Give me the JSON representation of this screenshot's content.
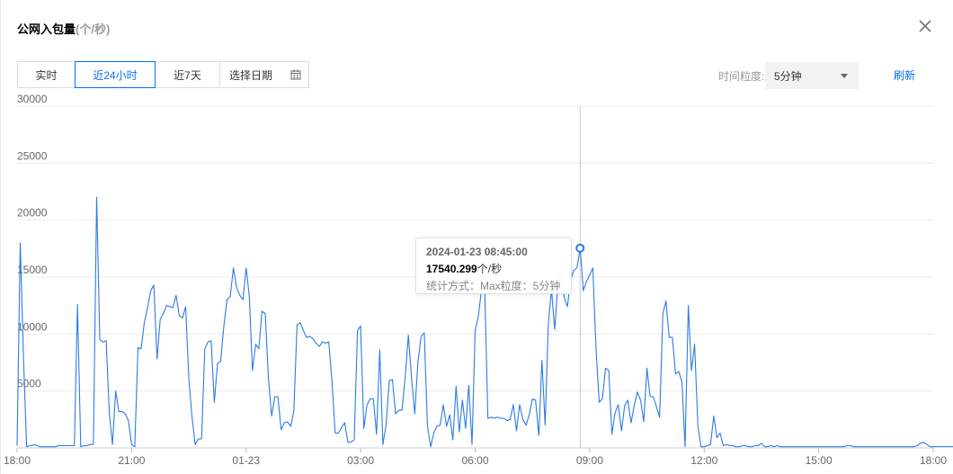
{
  "header": {
    "title": "公网入包量",
    "unit": "(个/秒)"
  },
  "tabs": [
    {
      "label": "实时",
      "active": false
    },
    {
      "label": "近24小时",
      "active": true
    },
    {
      "label": "近7天",
      "active": false
    },
    {
      "label": "选择日期",
      "active": false
    }
  ],
  "granularity": {
    "label": "时间粒度:",
    "value": "5分钟"
  },
  "refresh_label": "刷新",
  "tooltip": {
    "time": "2024-01-23 08:45:00",
    "value": "17540.299",
    "unit": "个/秒",
    "meta": "统计方式：Max粒度：5分钟"
  },
  "colors": {
    "line": "#2b7be4",
    "accent": "#006eff",
    "grid": "#ececec"
  },
  "chart_data": {
    "type": "line",
    "title": "",
    "xlabel": "",
    "ylabel": "",
    "ylim": [
      0,
      30000
    ],
    "yticks": [
      "30000",
      "25000",
      "20000",
      "15000",
      "10000",
      "5000"
    ],
    "xticks": [
      {
        "label": "18:00",
        "h": 0
      },
      {
        "label": "21:00",
        "h": 3
      },
      {
        "label": "01-23",
        "h": 6
      },
      {
        "label": "03:00",
        "h": 9
      },
      {
        "label": "06:00",
        "h": 12
      },
      {
        "label": "09:00",
        "h": 15
      },
      {
        "label": "12:00",
        "h": 18
      },
      {
        "label": "15:00",
        "h": 21
      },
      {
        "label": "18:00",
        "h": 24
      }
    ],
    "x_unit": "hours since 2024-01-22 18:00, 5-minute steps",
    "highlight_index": 177,
    "series": [
      {
        "values": [
          200,
          18000,
          8000,
          100,
          200,
          250,
          250,
          100,
          100,
          100,
          100,
          100,
          100,
          200,
          200,
          200,
          200,
          200,
          200,
          12600,
          100,
          200,
          200,
          300,
          300,
          22000,
          9500,
          9300,
          9400,
          3000,
          300,
          5000,
          3200,
          3200,
          3000,
          2400,
          300,
          100,
          8800,
          8700,
          11000,
          12300,
          13800,
          14300,
          7800,
          11300,
          11800,
          12500,
          12400,
          12300,
          13400,
          11600,
          11400,
          12400,
          6000,
          2700,
          300,
          800,
          800,
          8700,
          9300,
          9400,
          4000,
          7400,
          7600,
          10700,
          13000,
          13300,
          15800,
          14100,
          13400,
          13000,
          15800,
          13300,
          6800,
          9100,
          8700,
          12000,
          11800,
          6200,
          2800,
          4500,
          4500,
          1600,
          2200,
          2300,
          1900,
          3200,
          10800,
          11000,
          10300,
          9700,
          9800,
          9600,
          9200,
          8900,
          9300,
          9200,
          9300,
          5800,
          1300,
          1300,
          1800,
          2200,
          500,
          500,
          700,
          10300,
          10700,
          1700,
          3800,
          4300,
          4300,
          1200,
          8600,
          300,
          2000,
          5900,
          6000,
          3000,
          3300,
          3300,
          6200,
          9900,
          6200,
          3000,
          7500,
          9800,
          10100,
          2000,
          100,
          1300,
          1900,
          2000,
          3800,
          1900,
          2900,
          700,
          5400,
          1400,
          4200,
          1700,
          5500,
          300,
          10300,
          11500,
          13900,
          14100,
          2600,
          2700,
          2600,
          2700,
          2600,
          2600,
          2400,
          2500,
          3800,
          1500,
          3800,
          2500,
          2000,
          2900,
          4300,
          4200,
          1100,
          7700,
          2000,
          10900,
          13900,
          10400,
          14400,
          15600,
          13200,
          12400,
          14700,
          15600,
          15800,
          17540,
          13800,
          14600,
          15200,
          15800,
          8600,
          4000,
          4300,
          7000,
          6800,
          1200,
          3100,
          3800,
          1500,
          3700,
          4200,
          2200,
          3700,
          4900,
          4200,
          2300,
          7000,
          4500,
          4500,
          3600,
          2700,
          11800,
          12900,
          9700,
          9700,
          6500,
          6700,
          5800,
          100,
          12500,
          6800,
          9100,
          2000,
          100,
          100,
          200,
          300,
          2800,
          900,
          1300,
          200,
          300,
          200,
          200,
          100,
          100,
          200,
          200,
          100,
          100,
          200,
          200,
          400,
          100,
          100,
          200,
          100,
          200,
          100,
          100,
          100,
          100,
          100,
          100,
          100,
          100,
          100,
          100,
          100,
          100,
          100,
          100,
          100,
          100,
          100,
          100,
          100,
          100,
          100,
          200,
          200,
          100,
          100,
          100,
          100,
          100,
          100,
          100,
          100,
          100,
          100,
          100,
          100,
          100,
          100,
          100,
          100,
          100,
          100,
          100,
          100,
          200,
          400,
          500,
          300,
          100,
          100,
          100,
          100,
          100,
          100,
          100,
          100,
          100,
          100,
          200,
          200
        ]
      }
    ]
  }
}
